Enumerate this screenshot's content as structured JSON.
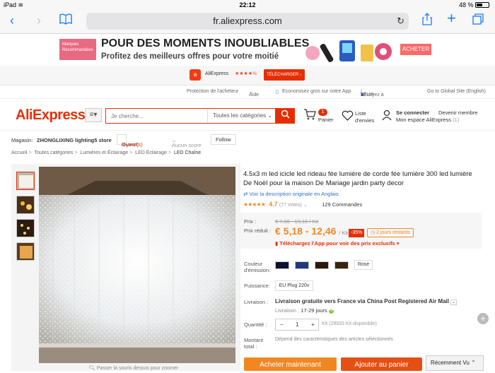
{
  "status": {
    "device": "iPad",
    "time": "22:12",
    "battery": "48 %"
  },
  "browser": {
    "url": "fr.aliexpress.com"
  },
  "banner": {
    "badge": "Marques Recommandées",
    "headline": "POUR DES MOMENTS INOUBLIABLES",
    "subline": "Profitez des meilleurs offres pour votre moitié",
    "cta": "ACHETER"
  },
  "appbar": {
    "name": "AliExpress",
    "stars": "★★★★½",
    "download": "TÉLÉCHARGER"
  },
  "toplinks": {
    "protection": "Protection de l'acheteur",
    "help": "Aide",
    "app": "Economisez gros sur notre App",
    "ship_to": "Envoyez à",
    "currency": "EUR",
    "global": "Go to Global Site (English)"
  },
  "header": {
    "logo": "AliExpress",
    "search_placeholder": "Je cherche...",
    "all_categories": "Toutes les catégories",
    "cart_count": "1",
    "cart_label": "Panier",
    "wishlist_label_1": "Liste",
    "wishlist_label_2": "d'envies",
    "signin": "Se connecter",
    "member": "Devenir membre",
    "myspace": "Mon espace AliExpress",
    "myspace_count": "(1)"
  },
  "store": {
    "label": "Magasin:",
    "name": "ZHONGLIXING lighting5 store",
    "opened_label": "Ouvert:",
    "opened_value": "3 year(s)",
    "score": "Aucun score",
    "follow": "Follow"
  },
  "breadcrumb": [
    "Accueil",
    "Toutes catégories",
    "Lumières et Éclairage",
    "LED Éclairage",
    "LED Chaîne"
  ],
  "gallery": {
    "zoom_hint": "Passer la souris dessus pour zoomer"
  },
  "product": {
    "title": "4.5x3 m led icicle led rideau fée lumière de corde fée lumière 300 led lumière De Noël pour la maison De Mariage jardin party decor",
    "translate": "Voir la description originale en Anglais",
    "stars": "★★★★★",
    "rating": "4.7",
    "votes": "(77 Votes)",
    "orders": "129 Commandes",
    "price_label": "Prix :",
    "old_price": "€ 7,96 - 19,16 / Kit",
    "sale_label": "Prix réduit :",
    "new_price": "€ 5,18 - 12,46",
    "unit": "/ Kit",
    "discount": "-35%",
    "days_left": "2 jours restants",
    "app_price": "Téléchargez l'App pour voir des prix exclusifs",
    "color_label": "Couleur d'émission:",
    "color_extra": "Rose",
    "power_label": "Puissance:",
    "power_value": "EU Plug 220v",
    "shipping_label": "Livraison :",
    "shipping": "Livraison gratuite vers France via China Post Registered Air Mail",
    "delivery_label": "Livraison :",
    "delivery_days": "17-29 jours",
    "qty_label": "Quantité :",
    "qty_value": "1",
    "stock": "Kit (29933 Kit disponible)",
    "total_label": "Montant total :",
    "total_note": "Dépend des caractéristiques des articles sélectionnés",
    "buy_now": "Acheter maintenant",
    "add_cart": "Ajouter au panier",
    "recent": "Récemment Vu"
  },
  "colors": {
    "accent": "#e62e04",
    "orange": "#f28722",
    "link": "#1a7cf5"
  }
}
